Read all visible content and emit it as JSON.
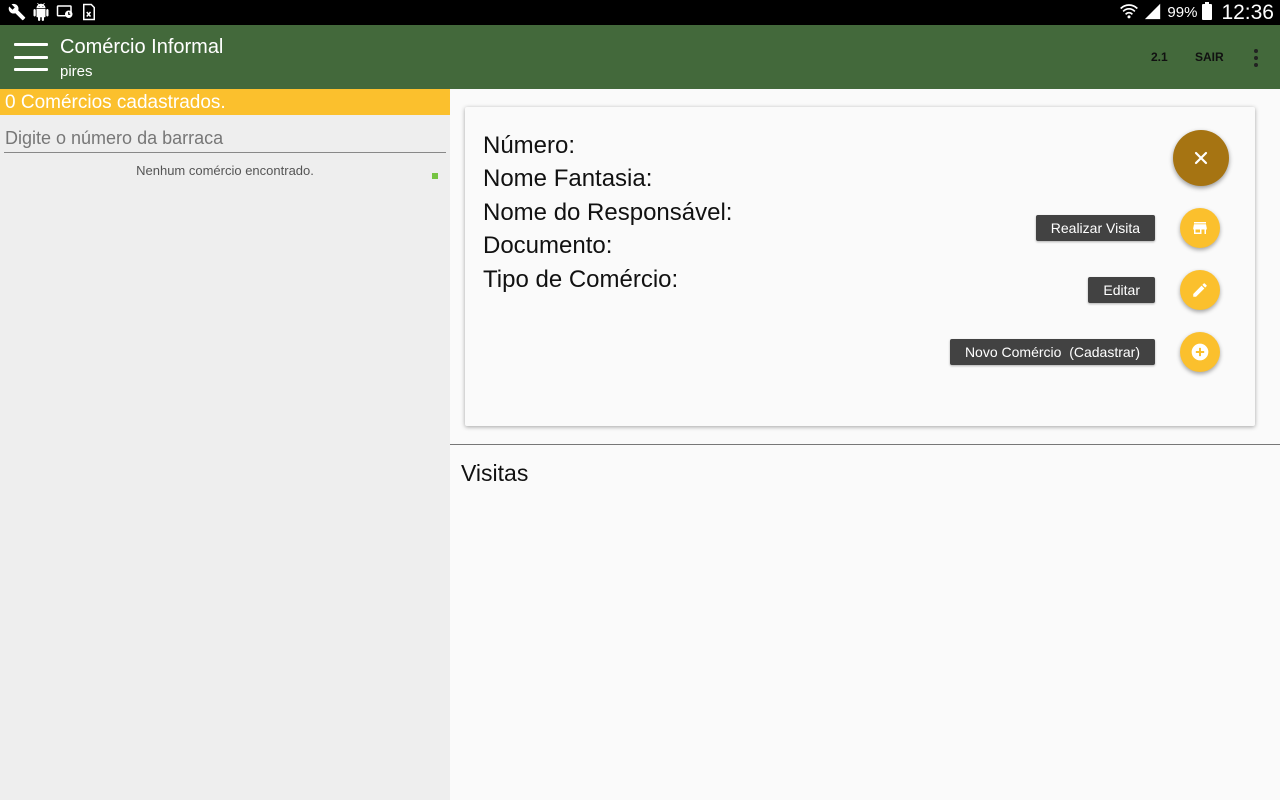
{
  "status_bar": {
    "battery_text": "99%",
    "time": "12:36",
    "icons": [
      "wrench-icon",
      "android-debug-icon",
      "screen-cast-icon",
      "document-icon",
      "wifi-icon",
      "signal-icon",
      "battery-icon"
    ]
  },
  "app_bar": {
    "title": "Comércio Informal",
    "subtitle": "pires",
    "version": "2.1",
    "logout": "SAIR",
    "color": "#43693b"
  },
  "left_panel": {
    "count_text": "0 Comércios cadastrados.",
    "search_placeholder": "Digite o número da barraca",
    "empty_message": "Nenhum comércio encontrado.",
    "accent": "#fbc02d"
  },
  "details": {
    "fields": [
      "Número:",
      "Nome Fantasia:",
      "Nome do Responsável:",
      "Documento:",
      "Tipo de Comércio:"
    ]
  },
  "fab_menu": {
    "main_icon": "close-icon",
    "actions": [
      {
        "label": "Realizar Visita",
        "icon": "store-icon"
      },
      {
        "label": "Editar",
        "icon": "pencil-icon"
      },
      {
        "label": "Novo Comércio  (Cadastrar)",
        "icon": "add-circle-icon"
      }
    ]
  },
  "visits": {
    "title": "Visitas"
  }
}
